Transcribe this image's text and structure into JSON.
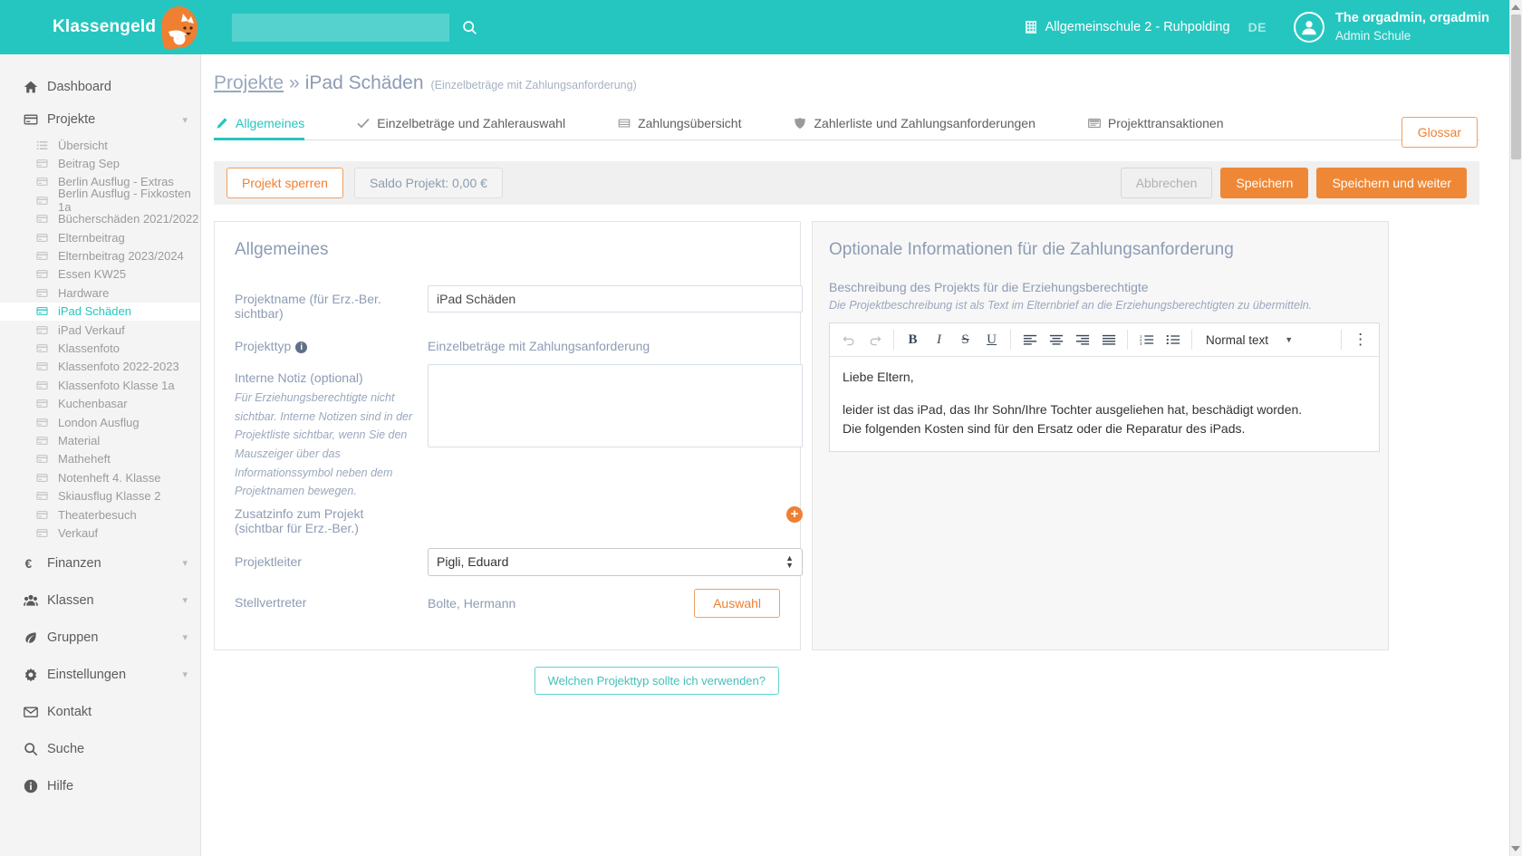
{
  "app": {
    "brand": "Klassengeld",
    "accent_teal": "#26c6c0",
    "accent_orange": "#ee8836",
    "label_blue": "#8d9cb3"
  },
  "header": {
    "search_placeholder": "",
    "search_value": "",
    "search_icon": "search-icon",
    "school": "Allgemeinschule 2 - Ruhpolding",
    "school_icon": "building-icon",
    "language": "DE",
    "user_name": "The orgadmin, orgadmin",
    "user_role": "Admin Schule"
  },
  "sidebar": {
    "items": [
      {
        "label": "Dashboard",
        "icon": "home-icon",
        "expandable": false
      },
      {
        "label": "Projekte",
        "icon": "card-icon",
        "expandable": true
      }
    ],
    "projects": [
      {
        "label": "Übersicht",
        "icon": "list-icon",
        "active": false
      },
      {
        "label": "Beitrag Sep",
        "icon": "card-icon",
        "active": false
      },
      {
        "label": "Berlin Ausflug - Extras",
        "icon": "card-icon",
        "active": false
      },
      {
        "label": "Berlin Ausflug - Fixkosten 1a",
        "icon": "card-icon",
        "active": false
      },
      {
        "label": "Bücherschäden 2021/2022",
        "icon": "card-icon",
        "active": false
      },
      {
        "label": "Elternbeitrag",
        "icon": "card-icon",
        "active": false
      },
      {
        "label": "Elternbeitrag 2023/2024",
        "icon": "card-icon",
        "active": false
      },
      {
        "label": "Essen KW25",
        "icon": "card-icon",
        "active": false
      },
      {
        "label": "Hardware",
        "icon": "card-icon",
        "active": false
      },
      {
        "label": "iPad Schäden",
        "icon": "card-icon",
        "active": true
      },
      {
        "label": "iPad Verkauf",
        "icon": "card-icon",
        "active": false
      },
      {
        "label": "Klassenfoto",
        "icon": "card-icon",
        "active": false
      },
      {
        "label": "Klassenfoto 2022-2023",
        "icon": "card-icon",
        "active": false
      },
      {
        "label": "Klassenfoto Klasse 1a",
        "icon": "card-icon",
        "active": false
      },
      {
        "label": "Kuchenbasar",
        "icon": "card-icon",
        "active": false
      },
      {
        "label": "London Ausflug",
        "icon": "card-icon",
        "active": false
      },
      {
        "label": "Material",
        "icon": "card-icon",
        "active": false
      },
      {
        "label": "Matheheft",
        "icon": "card-icon",
        "active": false
      },
      {
        "label": "Notenheft 4. Klasse",
        "icon": "card-icon",
        "active": false
      },
      {
        "label": "Skiausflug Klasse 2",
        "icon": "card-icon",
        "active": false
      },
      {
        "label": "Theaterbesuch",
        "icon": "card-icon",
        "active": false
      },
      {
        "label": "Verkauf",
        "icon": "card-icon",
        "active": false
      }
    ],
    "bottom_items": [
      {
        "label": "Finanzen",
        "icon": "euro-icon",
        "expandable": true
      },
      {
        "label": "Klassen",
        "icon": "users-icon",
        "expandable": true
      },
      {
        "label": "Gruppen",
        "icon": "leaf-icon",
        "expandable": true
      },
      {
        "label": "Einstellungen",
        "icon": "gear-icon",
        "expandable": true
      },
      {
        "label": "Kontakt",
        "icon": "envelope-icon",
        "expandable": false
      },
      {
        "label": "Suche",
        "icon": "search-icon",
        "expandable": false
      },
      {
        "label": "Hilfe",
        "icon": "info-icon",
        "expandable": false
      }
    ]
  },
  "breadcrumb": {
    "root": "Projekte",
    "separator": "»",
    "current": "iPad Schäden",
    "type_note": "(Einzelbeträge mit Zahlungsanforderung)"
  },
  "glossar_button": "Glossar",
  "tabs": [
    {
      "label": "Allgemeines",
      "icon": "pencil-icon",
      "active": true
    },
    {
      "label": "Einzelbeträge und Zahlerauswahl",
      "icon": "check-icon",
      "active": false
    },
    {
      "label": "Zahlungsübersicht",
      "icon": "table-icon",
      "active": false
    },
    {
      "label": "Zahlerliste und Zahlungsanforderungen",
      "icon": "shield-icon",
      "active": false
    },
    {
      "label": "Projekttransaktionen",
      "icon": "window-icon",
      "active": false
    }
  ],
  "toolbar": {
    "lock_project": "Projekt sperren",
    "balance": "Saldo Projekt: 0,00 €",
    "cancel": "Abbrechen",
    "save": "Speichern",
    "save_continue": "Speichern und weiter"
  },
  "left_card": {
    "title": "Allgemeines",
    "project_name_label": "Projektname (für Erz.-Ber. sichtbar)",
    "project_name_value": "iPad Schäden",
    "project_type_label": "Projekttyp",
    "project_type_info_icon": "info-icon",
    "project_type_value": "Einzelbeträge mit Zahlungsanforderung",
    "internal_note_label": "Interne Notiz (optional)",
    "internal_note_hint": "Für Erziehungsberechtigte nicht sichtbar. Interne Notizen sind in der Projektliste sichtbar, wenn Sie den Mauszeiger über das Informationssymbol neben dem Projektnamen bewegen.",
    "internal_note_value": "",
    "extra_info_label_line1": "Zusatzinfo zum Projekt",
    "extra_info_label_line2": "(sichtbar für Erz.-Ber.)",
    "add_icon": "plus-circle-icon",
    "project_leader_label": "Projektleiter",
    "project_leader_value": "Pigli, Eduard",
    "deputy_label": "Stellvertreter",
    "deputy_value": "Bolte, Hermann",
    "deputy_button": "Auswahl",
    "help_button": "Welchen Projekttyp sollte ich verwenden?"
  },
  "right_card": {
    "title": "Optionale Informationen für die Zahlungsanforderung",
    "subtitle": "Beschreibung des Projekts für die Erziehungsberechtigte",
    "hint": "Die Projektbeschreibung ist als Text im Elternbrief an die Erziehungsberechtigten zu übermitteln.",
    "editor_toolbar": {
      "undo": "undo-icon",
      "redo": "redo-icon",
      "bold": "B",
      "italic": "I",
      "strike": "S",
      "underline": "U",
      "align_left": "align-left-icon",
      "align_center": "align-center-icon",
      "align_right": "align-right-icon",
      "align_justify": "align-justify-icon",
      "ordered_list": "ordered-list-icon",
      "bullet_list": "bullet-list-icon",
      "style_select": "Normal text",
      "more": "more-vertical-icon"
    },
    "editor_content": [
      "Liebe Eltern,",
      "",
      "leider ist das iPad, das Ihr Sohn/Ihre Tochter ausgeliehen hat, beschädigt worden.",
      "Die folgenden Kosten sind für den Ersatz oder die Reparatur des iPads."
    ]
  }
}
